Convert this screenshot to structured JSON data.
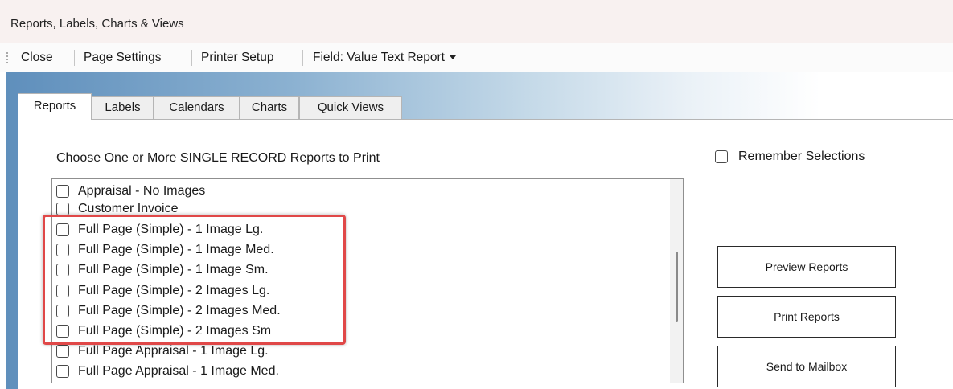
{
  "window": {
    "title": "Reports, Labels, Charts & Views"
  },
  "toolbar": {
    "close": "Close",
    "page_settings": "Page Settings",
    "printer_setup": "Printer Setup",
    "field_report": "Field: Value Text Report"
  },
  "tabs": [
    {
      "label": "Reports",
      "selected": true
    },
    {
      "label": "Labels",
      "selected": false
    },
    {
      "label": "Calendars",
      "selected": false
    },
    {
      "label": "Charts",
      "selected": false
    },
    {
      "label": "Quick Views",
      "selected": false
    }
  ],
  "panel": {
    "heading": "Choose One or More SINGLE RECORD Reports to Print",
    "remember_label": "Remember Selections",
    "remember_checked": false
  },
  "report_list": {
    "items": [
      {
        "label": "Appraisal - No Images",
        "checked": false
      },
      {
        "label": "Customer Invoice",
        "checked": false
      },
      {
        "label": "Full Page (Simple) - 1 Image Lg.",
        "checked": false
      },
      {
        "label": "Full Page (Simple) - 1 Image Med.",
        "checked": false
      },
      {
        "label": "Full Page (Simple) - 1 Image Sm.",
        "checked": false
      },
      {
        "label": "Full Page (Simple) - 2 Images Lg.",
        "checked": false
      },
      {
        "label": "Full Page (Simple) - 2 Images Med.",
        "checked": false
      },
      {
        "label": "Full Page (Simple) - 2 Images Sm",
        "checked": false
      },
      {
        "label": "Full Page Appraisal - 1 Image Lg.",
        "checked": false
      },
      {
        "label": "Full Page Appraisal - 1 Image Med.",
        "checked": false
      }
    ]
  },
  "buttons": {
    "preview": "Preview Reports",
    "print": "Print Reports",
    "mailbox": "Send to Mailbox"
  },
  "colors": {
    "highlight": "#e04848",
    "titlebar": "#f8f1f0",
    "workspace_gradient_start": "#5f8fbc"
  }
}
